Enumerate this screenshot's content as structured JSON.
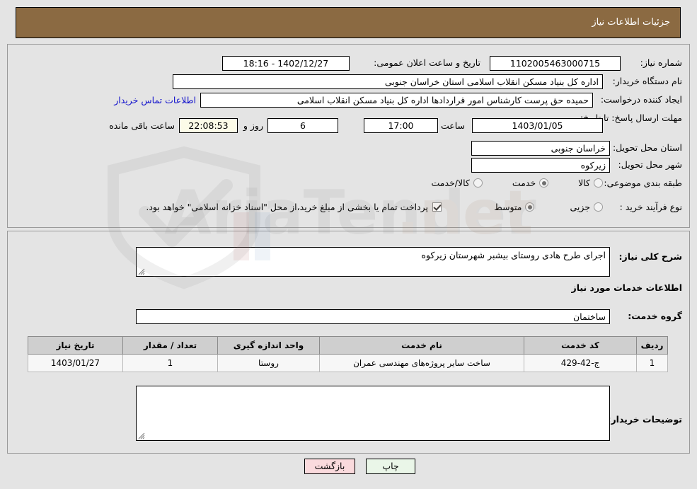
{
  "header": {
    "title": "جزئیات اطلاعات نیاز"
  },
  "form": {
    "need_number_label": "شماره نیاز:",
    "need_number_value": "1102005463000715",
    "announce_datetime_label": "تاریخ و ساعت اعلان عمومی:",
    "announce_datetime_value": "1402/12/27 - 18:16",
    "buyer_org_label": "نام دستگاه خریدار:",
    "buyer_org_value": "اداره کل بنیاد مسکن انقلاب اسلامی استان خراسان جنوبی",
    "creator_label": "ایجاد کننده درخواست:",
    "creator_value": "حمیده حق پرست کارشناس امور قراردادها اداره کل بنیاد مسکن انقلاب اسلامی",
    "contact_link": "اطلاعات تماس خریدار",
    "deadline_label": "مهلت ارسال پاسخ: تا تاریخ:",
    "deadline_date": "1403/01/05",
    "deadline_time_label": "ساعت",
    "deadline_time_value": "17:00",
    "remaining_days_value": "6",
    "remaining_days_label": "روز و",
    "remaining_time_value": "22:08:53",
    "remaining_time_label": "ساعت باقی مانده",
    "province_label": "استان محل تحویل:",
    "province_value": "خراسان جنوبی",
    "city_label": "شهر محل تحویل:",
    "city_value": "زیرکوه",
    "category_label": "طبقه بندی موضوعی:",
    "category_options": [
      {
        "label": "کالا",
        "selected": false
      },
      {
        "label": "خدمت",
        "selected": true
      },
      {
        "label": "کالا/خدمت",
        "selected": false
      }
    ],
    "process_label": "نوع فرآیند خرید :",
    "process_options": [
      {
        "label": "جزیی",
        "selected": false
      },
      {
        "label": "متوسط",
        "selected": true
      }
    ],
    "treasury_checkbox_label": "پرداخت تمام یا بخشی از مبلغ خرید،از محل \"اسناد خزانه اسلامی\" خواهد بود.",
    "treasury_checked": true
  },
  "details": {
    "general_desc_label": "شرح کلی نیاز:",
    "general_desc_value": "اجرای طرح هادی روستای بیشبر شهرستان زیرکوه",
    "services_section_title": "اطلاعات خدمات مورد نیاز",
    "service_group_label": "گروه خدمت:",
    "service_group_value": "ساختمان",
    "buyer_notes_label": "توضیحات خریدار:",
    "buyer_notes_value": ""
  },
  "table": {
    "headers": [
      "ردیف",
      "کد خدمت",
      "نام خدمت",
      "واحد اندازه گیری",
      "تعداد / مقدار",
      "تاریخ نیاز"
    ],
    "rows": [
      {
        "index": "1",
        "code": "ج-42-429",
        "name": "ساخت سایر پروژه‌های مهندسی عمران",
        "unit": "روستا",
        "quantity": "1",
        "need_date": "1403/01/27"
      }
    ]
  },
  "footer": {
    "print_label": "چاپ",
    "back_label": "بازگشت"
  },
  "colors": {
    "header_bg": "#8b6a42",
    "page_bg": "#e4e4e4",
    "link": "#1111cc",
    "print_btn": "#eaf6e8",
    "back_btn": "#fadadd"
  }
}
